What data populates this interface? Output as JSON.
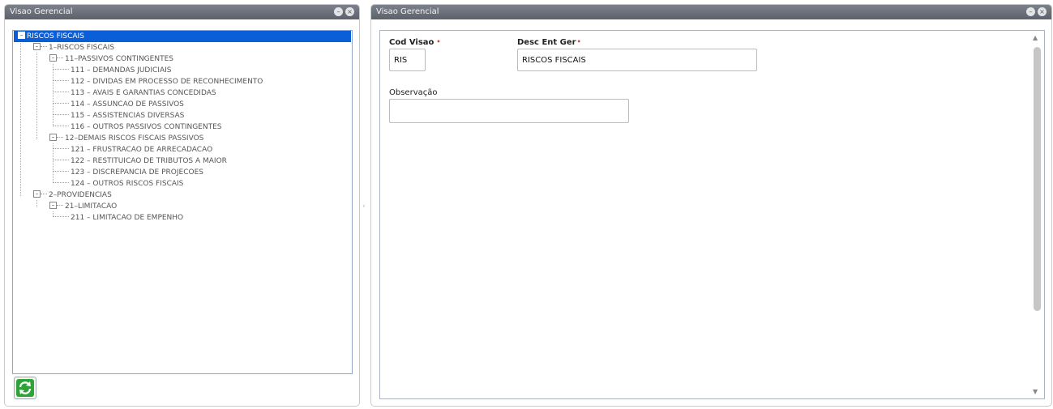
{
  "left_panel": {
    "title": "Visao Gerencial",
    "minimize_symbol": "–",
    "close_symbol": "×",
    "tree": {
      "root": "RISCOS FISCAIS",
      "items": [
        "1–RISCOS FISCAIS",
        "11–PASSIVOS CONTINGENTES",
        "111 – DEMANDAS JUDICIAIS",
        "112 – DIVIDAS EM PROCESSO DE RECONHECIMENTO",
        "113 – AVAIS E GARANTIAS CONCEDIDAS",
        "114 – ASSUNCAO DE PASSIVOS",
        "115 – ASSISTENCIAS DIVERSAS",
        "116 – OUTROS PASSIVOS CONTINGENTES",
        "12–DEMAIS RISCOS FISCAIS PASSIVOS",
        "121 – FRUSTRACAO DE ARRECADACAO",
        "122 – RESTITUICAO DE TRIBUTOS A MAIOR",
        "123 – DISCREPANCIA DE PROJECOES",
        "124 – OUTROS RISCOS FISCAIS",
        "2–PROVIDENCIAS",
        "21–LIMITACAO",
        "211 – LIMITACAO DE EMPENHO"
      ]
    },
    "refresh_icon": "refresh-icon"
  },
  "right_panel": {
    "title": "Visao Gerencial",
    "minimize_symbol": "–",
    "close_symbol": "×",
    "form": {
      "cod_visao_label": "Cod Visao",
      "cod_visao_value": "RIS",
      "desc_ent_ger_label": "Desc Ent Ger",
      "desc_ent_ger_value": "RISCOS FISCAIS",
      "observacao_label": "Observação",
      "observacao_value": "",
      "required_mark": "•"
    }
  },
  "colors": {
    "header": "#6b707a",
    "selection": "#0a5ed7",
    "required": "#e23b3b",
    "refresh_green": "#2fa338"
  }
}
